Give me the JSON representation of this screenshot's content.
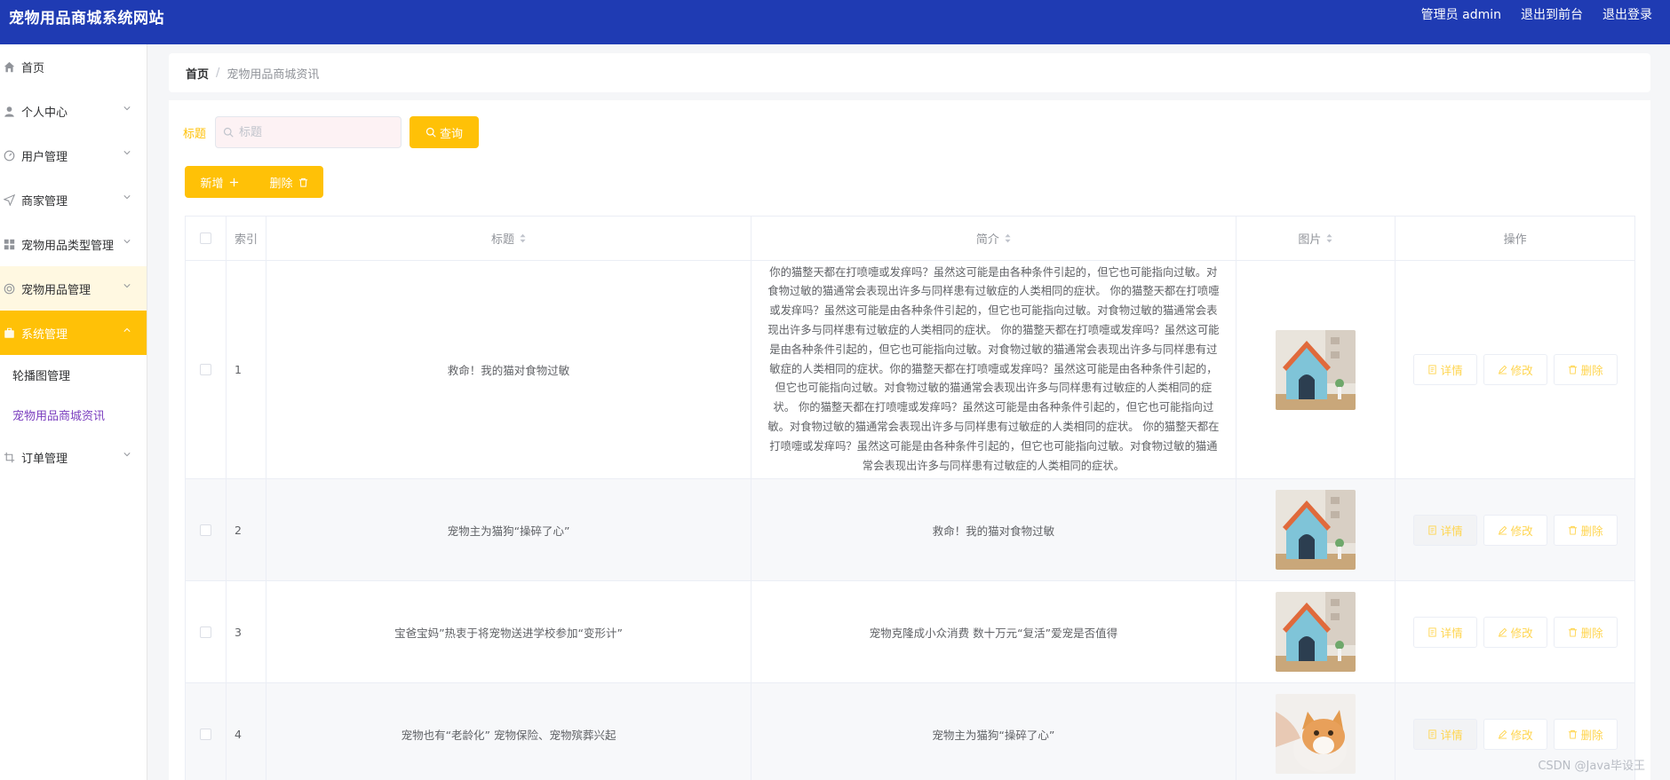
{
  "header": {
    "title": "宠物用品商城系统网站",
    "admin_label": "管理员 admin",
    "front_label": "退出到前台",
    "logout_label": "退出登录"
  },
  "sidebar": {
    "items": [
      {
        "label": "首页",
        "icon": "home-icon"
      },
      {
        "label": "个人中心",
        "icon": "user-icon"
      },
      {
        "label": "用户管理",
        "icon": "gauge-icon"
      },
      {
        "label": "商家管理",
        "icon": "send-icon"
      },
      {
        "label": "宠物用品类型管理",
        "icon": "grid-icon"
      },
      {
        "label": "宠物用品管理",
        "icon": "target-icon"
      },
      {
        "label": "系统管理",
        "icon": "briefcase-icon"
      },
      {
        "label": "订单管理",
        "icon": "crop-icon"
      }
    ],
    "sub_items": [
      "轮播图管理",
      "宠物用品商城资讯"
    ]
  },
  "breadcrumb": {
    "home": "首页",
    "separator": "/",
    "current": "宠物用品商城资讯"
  },
  "search": {
    "label": "标题",
    "placeholder": "标题",
    "button": "查询"
  },
  "actions": {
    "add": "新增",
    "delete": "删除"
  },
  "table": {
    "headers": {
      "index": "索引",
      "title": "标题",
      "intro": "简介",
      "image": "图片",
      "ops": "操作"
    },
    "ops_labels": {
      "detail": "详情",
      "edit": "修改",
      "delete": "删除"
    },
    "rows": [
      {
        "index": "1",
        "title": "救命！我的猫对食物过敏",
        "intro_lines": [
          "你的猫整天都在打喷嚏或发痒吗？虽然这可能是由各种条件引起的，但它也可能指向过敏。对",
          "食物过敏的猫通常会表现出许多与同样患有过敏症的人类相同的症状。 你的猫整天都在打喷嚏",
          "或发痒吗？虽然这可能是由各种条件引起的，但它也可能指向过敏。对食物过敏的猫通常会表",
          "现出许多与同样患有过敏症的人类相同的症状。 你的猫整天都在打喷嚏或发痒吗？虽然这可能",
          "是由各种条件引起的，但它也可能指向过敏。对食物过敏的猫通常会表现出许多与同样患有过",
          "敏症的人类相同的症状。你的猫整天都在打喷嚏或发痒吗？虽然这可能是由各种条件引起的，",
          "但它也可能指向过敏。对食物过敏的猫通常会表现出许多与同样患有过敏症的人类相同的症",
          "状。 你的猫整天都在打喷嚏或发痒吗？虽然这可能是由各种条件引起的，但它也可能指向过",
          "敏。对食物过敏的猫通常会表现出许多与同样患有过敏症的人类相同的症状。 你的猫整天都在",
          "打喷嚏或发痒吗？虽然这可能是由各种条件引起的，但它也可能指向过敏。对食物过敏的猫通",
          "常会表现出许多与同样患有过敏症的人类相同的症状。"
        ],
        "image": "pet-house"
      },
      {
        "index": "2",
        "title": "宠物主为猫狗“操碎了心”",
        "intro": "救命！我的猫对食物过敏",
        "image": "pet-house"
      },
      {
        "index": "3",
        "title": "宝爸宝妈”热衷于将宠物送进学校参加“变形计”",
        "intro": "宠物克隆成小众消费 数十万元“复活”爱宠是否值得",
        "image": "pet-house"
      },
      {
        "index": "4",
        "title": "宠物也有“老龄化” 宠物保险、宠物殡葬兴起",
        "intro": "宠物主为猫狗“操碎了心”",
        "image": "cat-photo"
      }
    ]
  },
  "watermark": "CSDN @Java毕设王",
  "colors": {
    "header_bg": "#1f3bb3",
    "accent": "#ffc107",
    "active_sub": "#7b3fbf"
  }
}
